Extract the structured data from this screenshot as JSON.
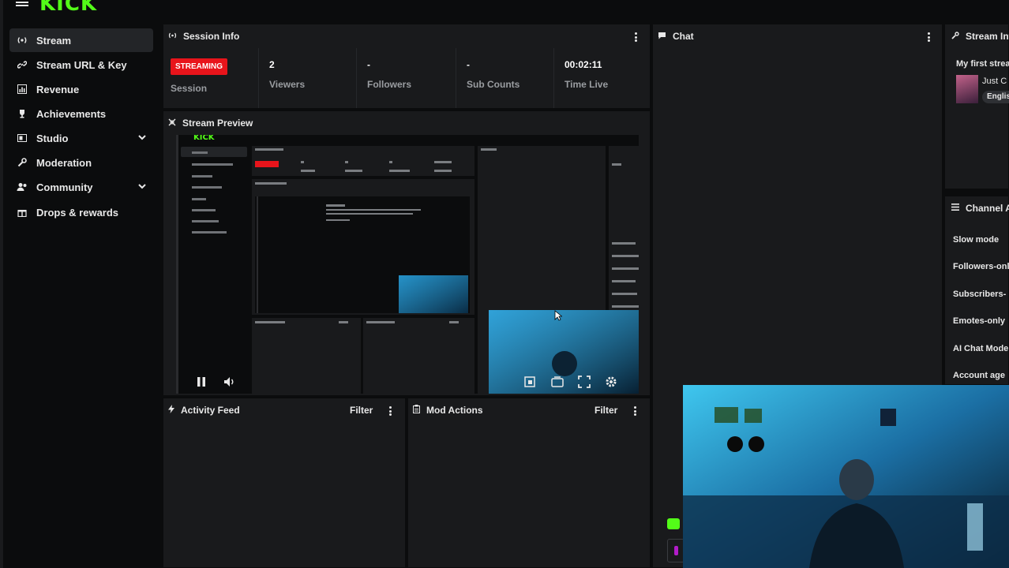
{
  "brand": {
    "logo_text": "KICK",
    "accent": "#53fc18"
  },
  "sidebar": {
    "items": [
      {
        "label": "Stream",
        "icon": "broadcast-icon",
        "active": true
      },
      {
        "label": "Stream URL & Key",
        "icon": "link-icon"
      },
      {
        "label": "Revenue",
        "icon": "chart-icon"
      },
      {
        "label": "Achievements",
        "icon": "trophy-icon"
      },
      {
        "label": "Studio",
        "icon": "studio-icon",
        "expandable": true
      },
      {
        "label": "Moderation",
        "icon": "wrench-icon"
      },
      {
        "label": "Community",
        "icon": "people-icon",
        "expandable": true
      },
      {
        "label": "Drops & rewards",
        "icon": "gift-icon"
      }
    ]
  },
  "session_info": {
    "title": "Session Info",
    "status_badge": "STREAMING",
    "status_badge_color": "#e8141b",
    "session_label": "Session",
    "stats": [
      {
        "value": "2",
        "label": "Viewers"
      },
      {
        "value": "-",
        "label": "Followers"
      },
      {
        "value": "-",
        "label": "Sub Counts"
      },
      {
        "value": "00:02:11",
        "label": "Time Live"
      }
    ]
  },
  "stream_preview": {
    "title": "Stream Preview"
  },
  "chat": {
    "title": "Chat"
  },
  "stream_info": {
    "title": "Stream Info",
    "stream_title": "My first strea",
    "category": "Just C",
    "language_tag": "Englis"
  },
  "channel_actions": {
    "title": "Channel Ac",
    "modes": [
      "Slow mode",
      "Followers-onl",
      "Subscribers-",
      "Emotes-only",
      "AI Chat Mode",
      "Account age"
    ]
  },
  "activity_feed": {
    "title": "Activity Feed",
    "filter_label": "Filter"
  },
  "mod_actions": {
    "title": "Mod Actions",
    "filter_label": "Filter"
  }
}
